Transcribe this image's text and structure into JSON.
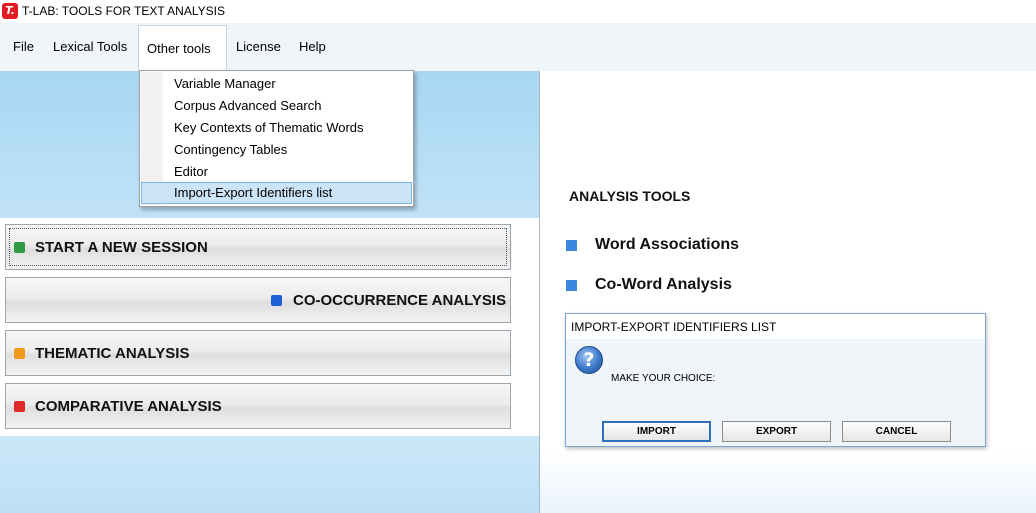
{
  "window": {
    "title": "T-LAB: TOOLS FOR TEXT ANALYSIS",
    "logo": "T."
  },
  "menubar": {
    "items": [
      {
        "label": "File"
      },
      {
        "label": "Lexical Tools"
      },
      {
        "label": "Other tools",
        "open": true
      },
      {
        "label": "License"
      },
      {
        "label": "Help"
      }
    ]
  },
  "dropdown": {
    "items": [
      {
        "label": "Variable Manager"
      },
      {
        "label": "Corpus Advanced Search"
      },
      {
        "label": "Key Contexts of Thematic Words"
      },
      {
        "label": "Contingency Tables"
      },
      {
        "label": "Editor"
      },
      {
        "label": "Import-Export Identifiers list",
        "highlighted": true
      }
    ]
  },
  "session_buttons": [
    {
      "label": "START A NEW SESSION",
      "color": "#2e9a46"
    },
    {
      "label": "CO-OCCURRENCE ANALYSIS",
      "color": "#1f5fd6"
    },
    {
      "label": "THEMATIC ANALYSIS",
      "color": "#f39a1e"
    },
    {
      "label": "COMPARATIVE ANALYSIS",
      "color": "#e02a2a"
    }
  ],
  "analysis_tools": {
    "title": "ANALYSIS TOOLS",
    "items": [
      {
        "label": "Word Associations"
      },
      {
        "label": "Co-Word Analysis"
      }
    ]
  },
  "dialog": {
    "title": "IMPORT-EXPORT IDENTIFIERS LIST",
    "icon": "question-icon",
    "message": "MAKE YOUR CHOICE:",
    "buttons": [
      {
        "label": "IMPORT",
        "default": true
      },
      {
        "label": "EXPORT"
      },
      {
        "label": "CANCEL"
      }
    ]
  },
  "colors": {
    "accent": "#3d86e0",
    "panel_gradient_top": "#a8d6f3"
  }
}
